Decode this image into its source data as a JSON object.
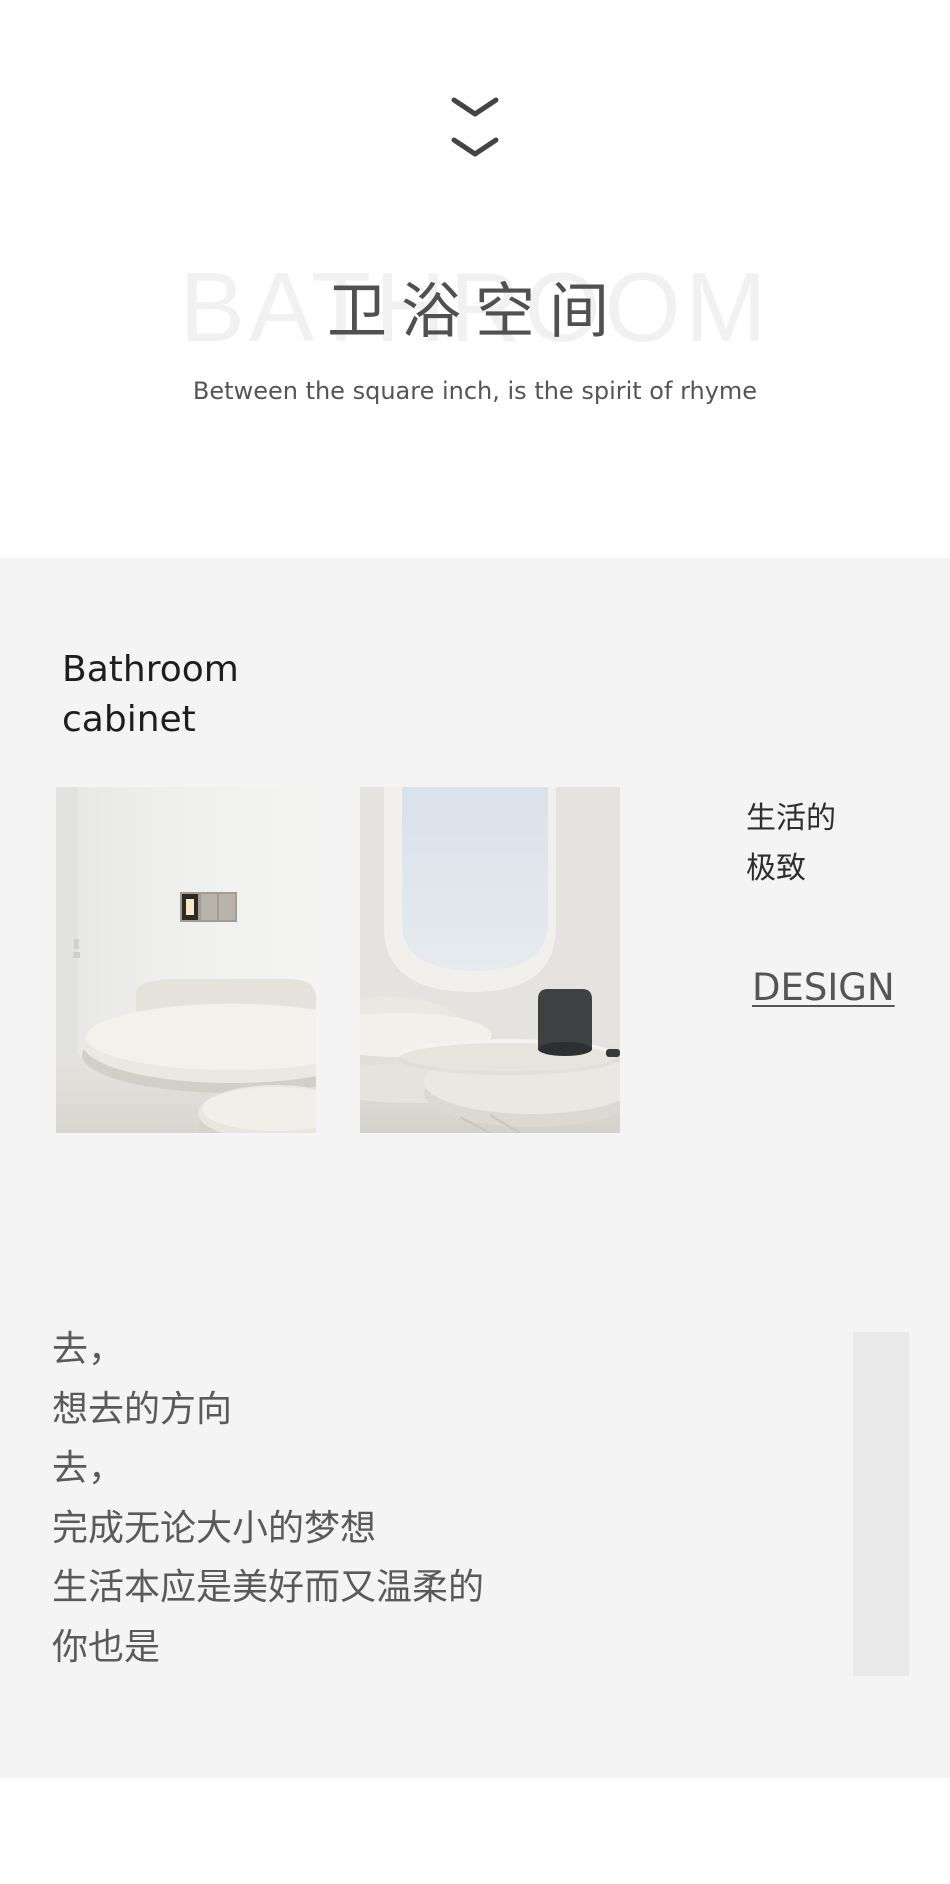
{
  "header": {
    "scroll_icon": "double-chevron-down-icon",
    "background_word": "BATHROOM",
    "title": "卫浴空间",
    "subtitle": "Between the square inch, is the spirit of rhyme"
  },
  "section": {
    "title_line1": "Bathroom",
    "title_line2": "cabinet",
    "side_label_line1": "生活的",
    "side_label_line2": "极致",
    "design_link": "DESIGN"
  },
  "poem": {
    "lines": [
      "去，",
      "想去的方向",
      "去，",
      "完成无论大小的梦想",
      "生活本应是美好而又温柔的",
      "你也是"
    ]
  },
  "colors": {
    "page_bg": "#ffffff",
    "section_bg": "#f4f4f4",
    "accent_block": "#e9e9e9",
    "title_text": "#505050",
    "watermark_text": "#f1f1f1"
  }
}
